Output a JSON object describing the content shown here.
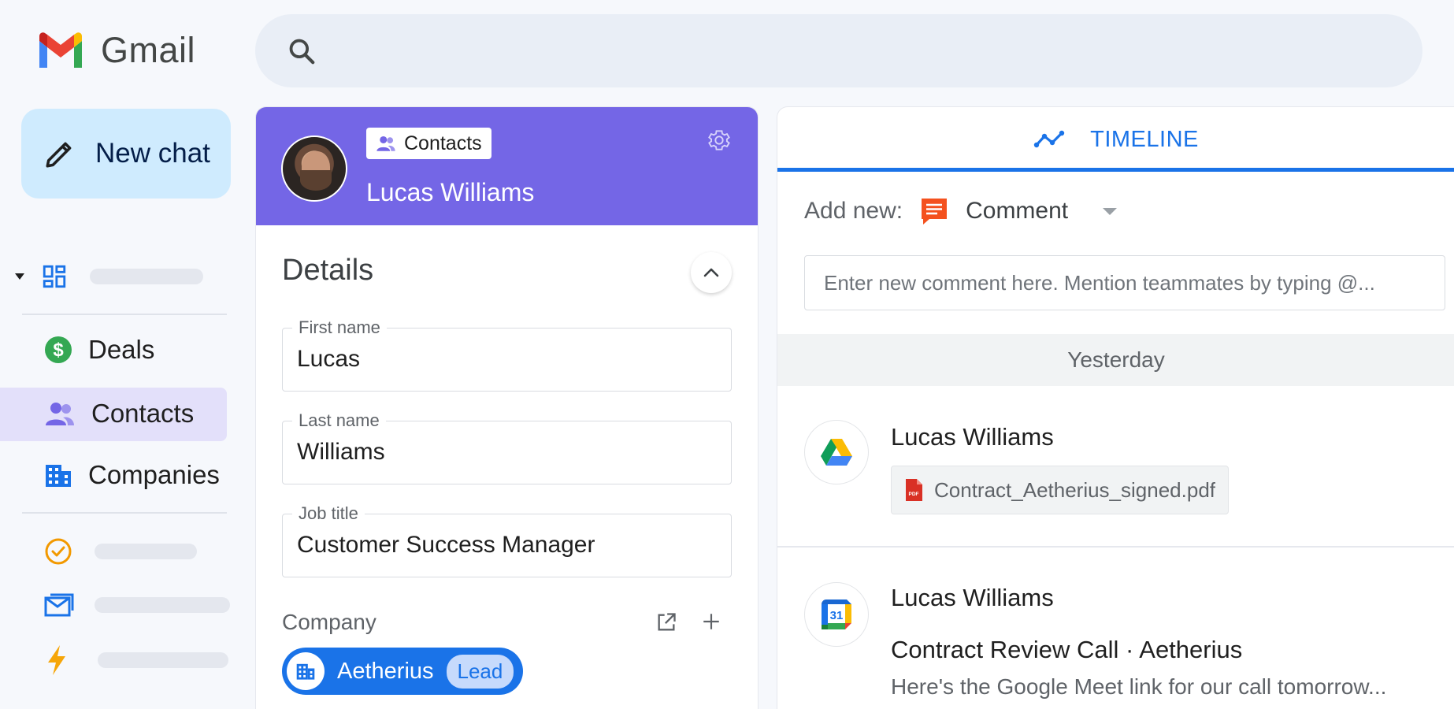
{
  "app": {
    "name": "Gmail"
  },
  "search": {
    "placeholder": ""
  },
  "sidebar": {
    "new_chat_label": "New chat",
    "items": [
      {
        "label": "Deals",
        "icon": "dollar-icon"
      },
      {
        "label": "Contacts",
        "icon": "contacts-icon",
        "selected": true
      },
      {
        "label": "Companies",
        "icon": "building-icon"
      }
    ]
  },
  "contact": {
    "chip_label": "Contacts",
    "name": "Lucas Williams",
    "details_title": "Details",
    "fields": [
      {
        "label": "First name",
        "value": "Lucas"
      },
      {
        "label": "Last name",
        "value": "Williams"
      },
      {
        "label": "Job title",
        "value": "Customer Success Manager"
      }
    ],
    "company_label": "Company",
    "company": {
      "name": "Aetherius",
      "badge": "Lead"
    }
  },
  "timeline": {
    "tab_label": "TIMELINE",
    "add_new_label": "Add new:",
    "add_new_type": "Comment",
    "comment_placeholder": "Enter new comment here. Mention teammates by typing @...",
    "day_label": "Yesterday",
    "entries": [
      {
        "author": "Lucas Williams",
        "icon": "google-drive-icon",
        "attachment": "Contract_Aetherius_signed.pdf"
      },
      {
        "author": "Lucas Williams",
        "icon": "google-calendar-icon",
        "calendar_day": "31",
        "title": "Contract Review Call · Aetherius",
        "description": "Here's the Google Meet link for our call tomorrow..."
      }
    ]
  },
  "colors": {
    "header_purple": "#7466e6",
    "accent_blue": "#1a73e8",
    "new_chat_bg": "#c2e7ff",
    "selected_nav_bg": "#e3e0fa"
  }
}
